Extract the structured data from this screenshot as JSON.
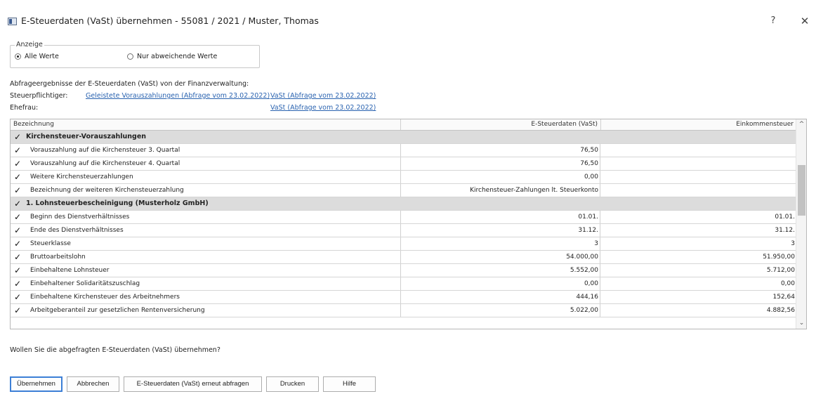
{
  "window": {
    "title": "E-Steuerdaten (VaSt) übernehmen  - 55081 / 2021 / Muster, Thomas",
    "help_label": "?",
    "close_label": "✕"
  },
  "display": {
    "legend": "Anzeige",
    "option_all": "Alle Werte",
    "option_diff": "Nur abweichende Werte",
    "selected": "Alle Werte"
  },
  "info": {
    "intro": "Abfrageergebnisse der E-Steuerdaten (VaSt) von der Finanzverwaltung:",
    "taxpayer_label": "Steuerpflichtiger:",
    "taxpayer_link_prepayments": "Geleistete Vorauszahlungen (Abfrage vom 23.02.2022)",
    "taxpayer_link_vast": "VaSt (Abfrage vom 23.02.2022)",
    "spouse_label": "Ehefrau:",
    "spouse_link_vast": "VaSt (Abfrage vom 23.02.2022)"
  },
  "table": {
    "columns": [
      "Bezeichnung",
      "E-Steuerdaten (VaSt)",
      "Einkommensteuer"
    ],
    "rows": [
      {
        "group": true,
        "checked": "✓",
        "label": "Kirchensteuer-Vorauszahlungen",
        "vast": "",
        "est": ""
      },
      {
        "group": false,
        "checked": "✓",
        "label": "Vorauszahlung auf die Kirchensteuer 3. Quartal",
        "vast": "76,50",
        "est": ""
      },
      {
        "group": false,
        "checked": "✓",
        "label": "Vorauszahlung auf die Kirchensteuer 4. Quartal",
        "vast": "76,50",
        "est": ""
      },
      {
        "group": false,
        "checked": "✓",
        "label": "Weitere Kirchensteuerzahlungen",
        "vast": "0,00",
        "est": ""
      },
      {
        "group": false,
        "checked": "✓",
        "label": "Bezeichnung der weiteren Kirchensteuerzahlung",
        "vast": "Kirchensteuer-Zahlungen lt. Steuerkonto",
        "est": ""
      },
      {
        "group": true,
        "checked": "✓",
        "label": "1. Lohnsteuerbescheinigung (Musterholz GmbH)",
        "vast": "",
        "est": ""
      },
      {
        "group": false,
        "checked": "✓",
        "label": "Beginn des Dienstverhältnisses",
        "vast": "01.01.",
        "est": "01.01."
      },
      {
        "group": false,
        "checked": "✓",
        "label": "Ende des Dienstverhältnisses",
        "vast": "31.12.",
        "est": "31.12."
      },
      {
        "group": false,
        "checked": "✓",
        "label": "Steuerklasse",
        "vast": "3",
        "est": "3"
      },
      {
        "group": false,
        "checked": "✓",
        "label": "Bruttoarbeitslohn",
        "vast": "54.000,00",
        "est": "51.950,00"
      },
      {
        "group": false,
        "checked": "✓",
        "label": "Einbehaltene Lohnsteuer",
        "vast": "5.552,00",
        "est": "5.712,00"
      },
      {
        "group": false,
        "checked": "✓",
        "label": "Einbehaltener Solidaritätszuschlag",
        "vast": "0,00",
        "est": "0,00"
      },
      {
        "group": false,
        "checked": "✓",
        "label": "Einbehaltene Kirchensteuer des Arbeitnehmers",
        "vast": "444,16",
        "est": "152,64"
      },
      {
        "group": false,
        "checked": "✓",
        "label": "Arbeitgeberanteil zur gesetzlichen Rentenversicherung",
        "vast": "5.022,00",
        "est": "4.882,56"
      }
    ],
    "scroll_up": "^",
    "scroll_down": "⌄"
  },
  "question": "Wollen Sie die abgefragten E-Steuerdaten (VaSt) übernehmen?",
  "buttons": {
    "accept": "Übernehmen",
    "cancel": "Abbrechen",
    "requery": "E-Steuerdaten (VaSt) erneut abfragen",
    "print": "Drucken",
    "help": "Hilfe"
  }
}
